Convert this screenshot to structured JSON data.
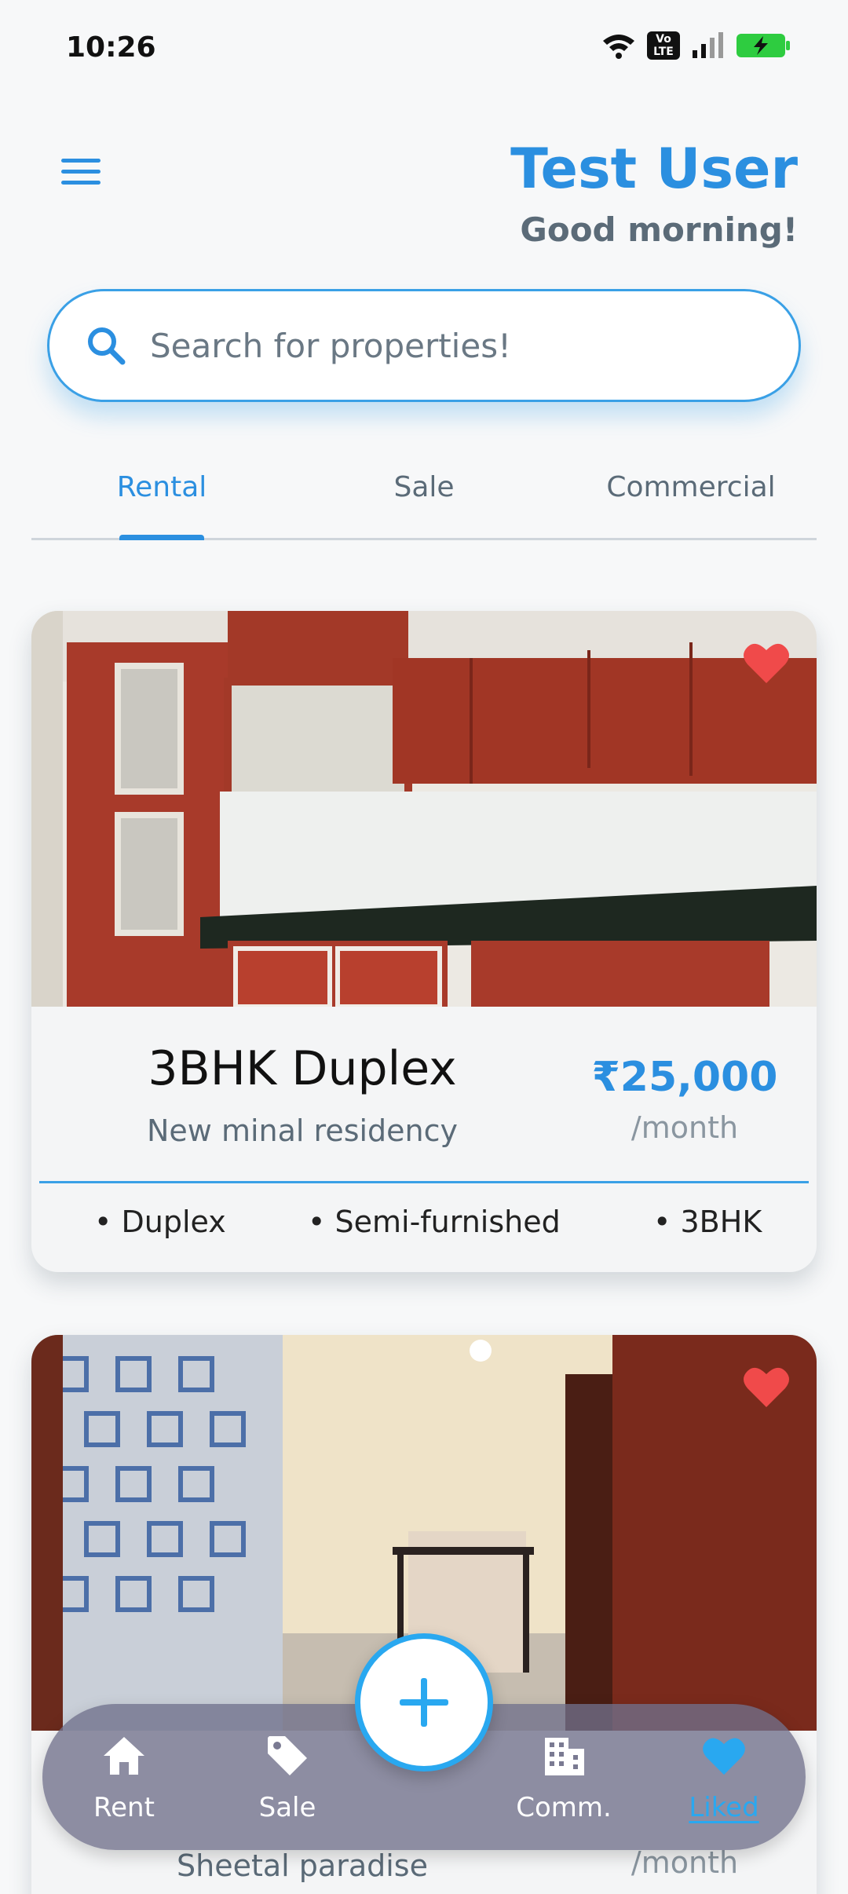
{
  "status_bar": {
    "time": "10:26",
    "volte_label": "Vo LTE",
    "icons": [
      "wifi-icon",
      "volte-icon",
      "signal-icon",
      "battery-charging-icon"
    ]
  },
  "header": {
    "menu_icon": "hamburger-menu-icon",
    "user_name": "Test User",
    "greeting": "Good morning!"
  },
  "search": {
    "icon": "search-icon",
    "placeholder": "Search for properties!",
    "value": ""
  },
  "tabs": {
    "items": [
      {
        "label": "Rental",
        "active": true
      },
      {
        "label": "Sale",
        "active": false
      },
      {
        "label": "Commercial",
        "active": false
      }
    ]
  },
  "listings": [
    {
      "title": "3BHK Duplex",
      "subtitle": "New minal residency",
      "price": "₹25,000",
      "period": "/month",
      "liked": true,
      "features": [
        "• Duplex",
        "• Semi-furnished",
        "• 3BHK"
      ],
      "image": "kitchen-photo"
    },
    {
      "title": "",
      "subtitle": "Sheetal paradise",
      "price": "",
      "period": "/month",
      "liked": true,
      "features": [],
      "image": "room-photo"
    }
  ],
  "bottom_nav": {
    "items": [
      {
        "label": "Rent",
        "icon": "home-icon",
        "active": false
      },
      {
        "label": "Sale",
        "icon": "tag-icon",
        "active": false
      },
      {
        "label": "Comm.",
        "icon": "building-icon",
        "active": false
      },
      {
        "label": "Liked",
        "icon": "heart-icon",
        "active": true
      }
    ],
    "fab_icon": "plus-icon"
  },
  "colors": {
    "accent": "#2b8fe0",
    "accent_light": "#29a8f0",
    "heart": "#f04a4a",
    "muted": "#5b6b78"
  }
}
